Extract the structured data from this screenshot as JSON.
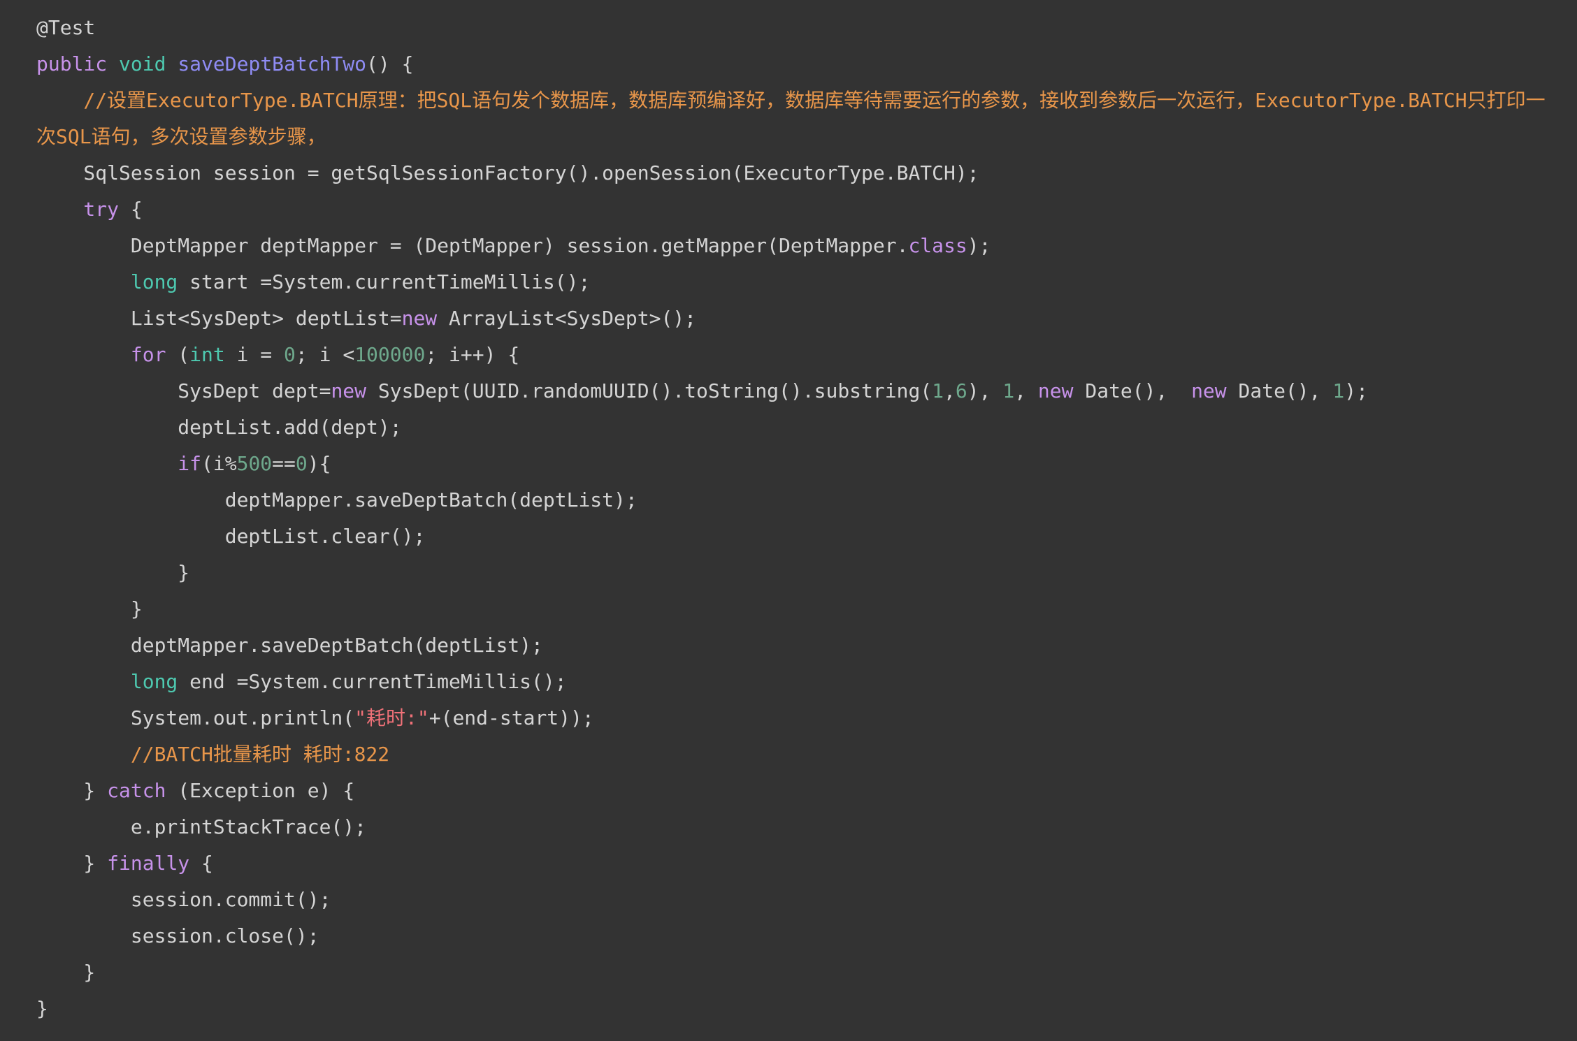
{
  "colors": {
    "background": "#333333",
    "plain": "#d4d4d4",
    "keyword": "#c792ea",
    "type": "#4ec9b0",
    "function": "#8f8cf4",
    "number": "#6ea88c",
    "string": "#f07178",
    "comment": "#e8964a"
  },
  "code": {
    "lines": [
      [
        [
          "ann",
          "@Test"
        ]
      ],
      [
        [
          "kw",
          "public "
        ],
        [
          "type",
          "void "
        ],
        [
          "fn",
          "saveDeptBatchTwo"
        ],
        [
          "plain",
          "() {"
        ]
      ],
      [
        [
          "cmt",
          "    //设置ExecutorType.BATCH原理：把SQL语句发个数据库，数据库预编译好，数据库等待需要运行的参数，接收到参数后一次运行，ExecutorType.BATCH只打印一"
        ]
      ],
      [
        [
          "cmt",
          "次SQL语句，多次设置参数步骤，"
        ]
      ],
      [
        [
          "plain",
          "    SqlSession session = getSqlSessionFactory().openSession(ExecutorType.BATCH);"
        ]
      ],
      [
        [
          "kw",
          "    try "
        ],
        [
          "plain",
          "{"
        ]
      ],
      [
        [
          "plain",
          "        DeptMapper deptMapper = (DeptMapper) session.getMapper(DeptMapper."
        ],
        [
          "kw",
          "class"
        ],
        [
          "plain",
          ");"
        ]
      ],
      [
        [
          "type",
          "        long "
        ],
        [
          "plain",
          "start =System.currentTimeMillis();"
        ]
      ],
      [
        [
          "plain",
          "        List<SysDept> deptList="
        ],
        [
          "kw",
          "new "
        ],
        [
          "plain",
          "ArrayList<SysDept>();"
        ]
      ],
      [
        [
          "kw",
          "        for "
        ],
        [
          "plain",
          "("
        ],
        [
          "type",
          "int "
        ],
        [
          "plain",
          "i = "
        ],
        [
          "num",
          "0"
        ],
        [
          "plain",
          "; i <"
        ],
        [
          "num",
          "100000"
        ],
        [
          "plain",
          "; i++) {"
        ]
      ],
      [
        [
          "plain",
          "            SysDept dept="
        ],
        [
          "kw",
          "new "
        ],
        [
          "plain",
          "SysDept(UUID.randomUUID().toString().substring("
        ],
        [
          "num",
          "1"
        ],
        [
          "plain",
          ","
        ],
        [
          "num",
          "6"
        ],
        [
          "plain",
          "), "
        ],
        [
          "num",
          "1"
        ],
        [
          "plain",
          ", "
        ],
        [
          "kw",
          "new "
        ],
        [
          "plain",
          "Date(),  "
        ],
        [
          "kw",
          "new "
        ],
        [
          "plain",
          "Date(), "
        ],
        [
          "num",
          "1"
        ],
        [
          "plain",
          ");"
        ]
      ],
      [
        [
          "plain",
          "            deptList.add(dept);"
        ]
      ],
      [
        [
          "kw",
          "            if"
        ],
        [
          "plain",
          "(i%"
        ],
        [
          "num",
          "500"
        ],
        [
          "plain",
          "=="
        ],
        [
          "num",
          "0"
        ],
        [
          "plain",
          "){"
        ]
      ],
      [
        [
          "plain",
          "                deptMapper.saveDeptBatch(deptList);"
        ]
      ],
      [
        [
          "plain",
          "                deptList.clear();"
        ]
      ],
      [
        [
          "plain",
          "            }"
        ]
      ],
      [
        [
          "plain",
          "        }"
        ]
      ],
      [
        [
          "plain",
          "        deptMapper.saveDeptBatch(deptList);"
        ]
      ],
      [
        [
          "type",
          "        long "
        ],
        [
          "plain",
          "end =System.currentTimeMillis();"
        ]
      ],
      [
        [
          "plain",
          "        System.out.println("
        ],
        [
          "str",
          "\"耗时:\""
        ],
        [
          "plain",
          "+(end-start));"
        ]
      ],
      [
        [
          "cmt",
          "        //BATCH批量耗时 耗时:822"
        ]
      ],
      [
        [
          "plain",
          "    } "
        ],
        [
          "kw",
          "catch "
        ],
        [
          "plain",
          "(Exception e) {"
        ]
      ],
      [
        [
          "plain",
          "        e.printStackTrace();"
        ]
      ],
      [
        [
          "plain",
          "    } "
        ],
        [
          "kw",
          "finally "
        ],
        [
          "plain",
          "{"
        ]
      ],
      [
        [
          "plain",
          "        session.commit();"
        ]
      ],
      [
        [
          "plain",
          "        session.close();"
        ]
      ],
      [
        [
          "plain",
          "    }"
        ]
      ],
      [
        [
          "plain",
          "}"
        ]
      ]
    ]
  }
}
